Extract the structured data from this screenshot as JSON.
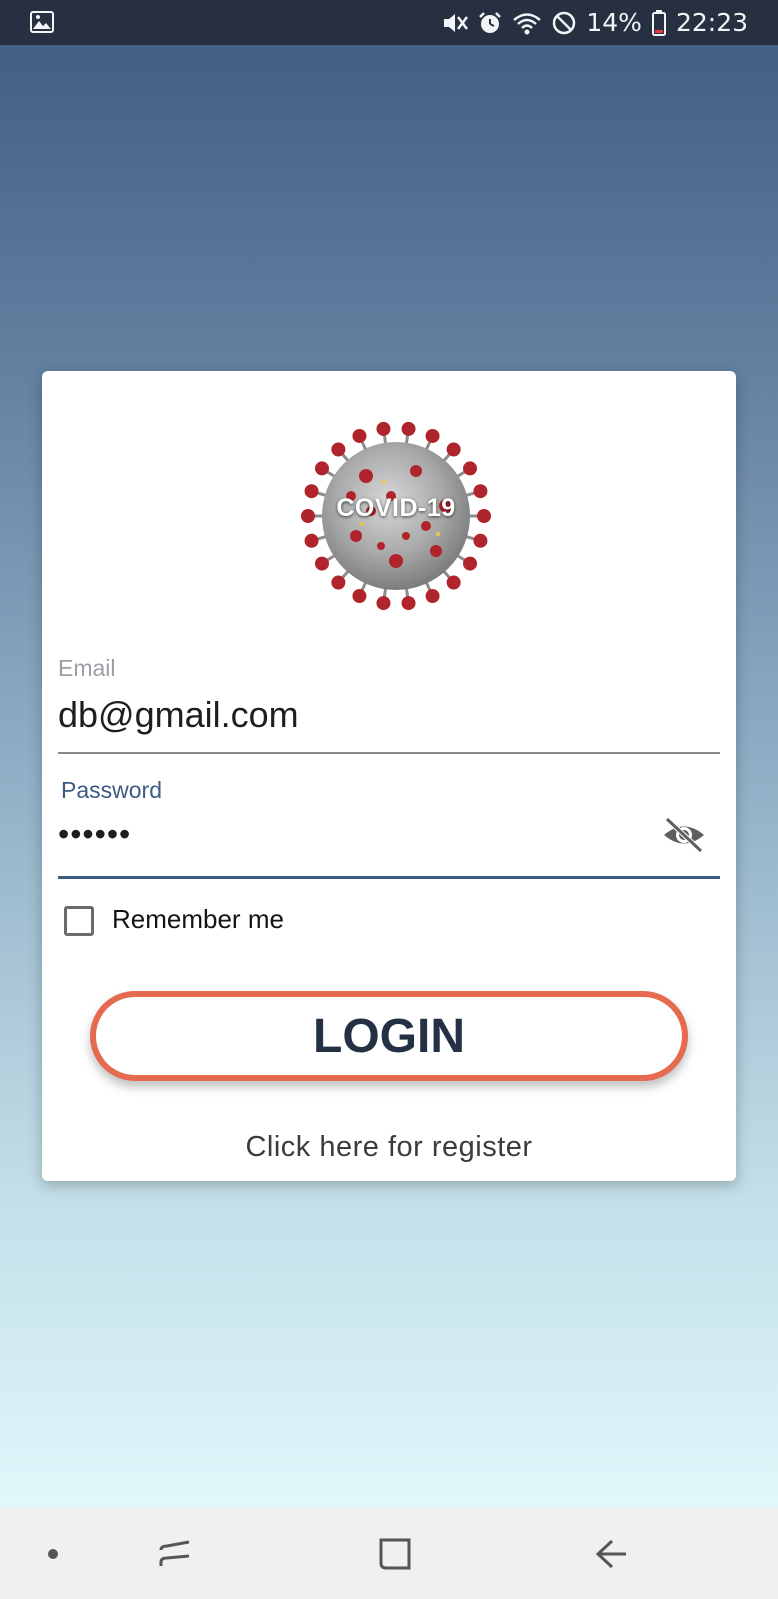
{
  "status_bar": {
    "battery_percent": "14%",
    "time": "22:23",
    "icons": [
      "gallery-icon",
      "mute-icon",
      "alarm-icon",
      "wifi-icon",
      "do-not-disturb-icon",
      "battery-icon"
    ]
  },
  "login_card": {
    "logo_text": "COVID-19",
    "email": {
      "label": "Email",
      "value": "db@gmail.com"
    },
    "password": {
      "label": "Password",
      "value": "••••••",
      "visibility_icon": "eye-off-icon"
    },
    "remember_me": {
      "label": "Remember me",
      "checked": false
    },
    "login_button_label": "LOGIN",
    "register_link": "Click here for register"
  },
  "nav_bar": {
    "items": [
      "dot-icon",
      "recents-icon",
      "home-icon",
      "back-icon"
    ]
  },
  "colors": {
    "status_bar_bg": "#263040",
    "accent": "#3d5a80",
    "login_border": "#e56a50",
    "login_text": "#243044",
    "virus_spikes": "#b0242c"
  }
}
